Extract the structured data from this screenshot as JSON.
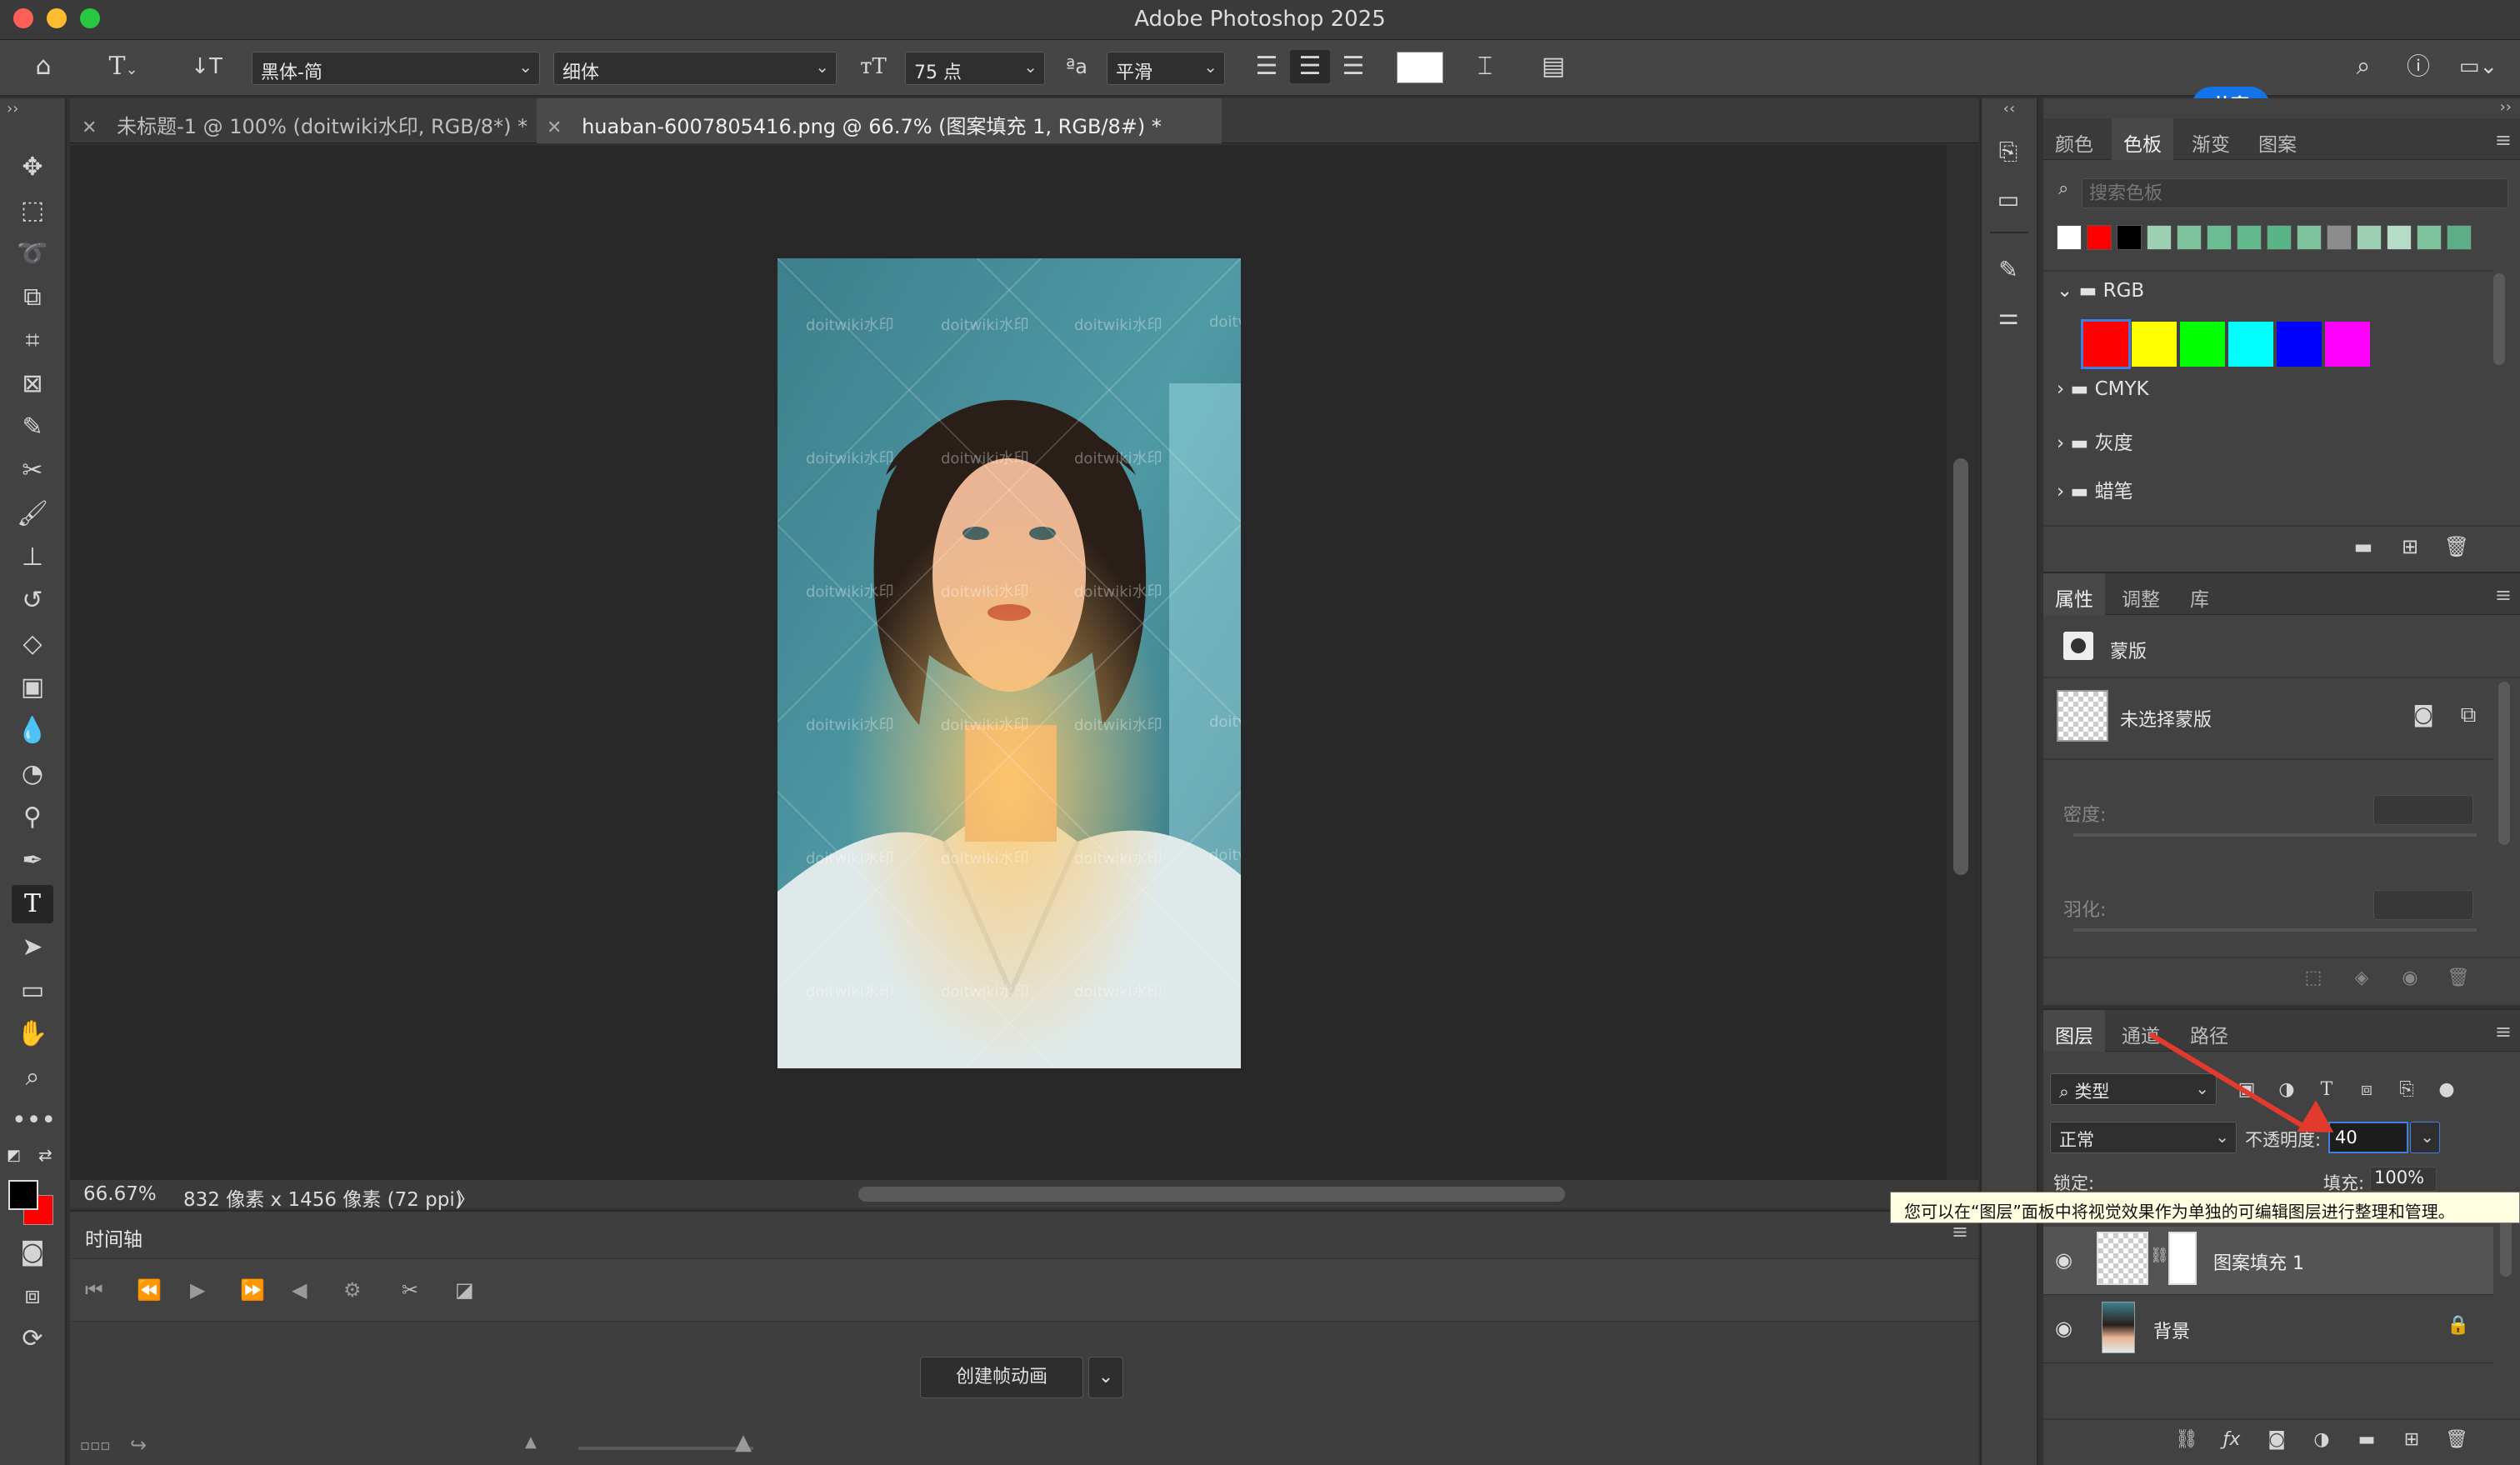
{
  "window": {
    "title": "Adobe Photoshop 2025"
  },
  "options": {
    "font_family": "黑体-简",
    "font_style": "细体",
    "font_size": "75 点",
    "aa_icon_text": "ªa",
    "antialias": "平滑",
    "share_label": "共享"
  },
  "tabs": [
    {
      "label": "未标题-1 @ 100% (doitwiki水印, RGB/8*) *",
      "active": false
    },
    {
      "label": "huaban-6007805416.png @ 66.7% (图案填充 1, RGB/8#) *",
      "active": true
    }
  ],
  "watermark_text": "doitwiki水印",
  "watermark_cut": "doitv",
  "status": {
    "zoom": "66.67%",
    "info": "832 像素 x 1456 像素 (72 ppi)",
    "chevron": "〉"
  },
  "timeline": {
    "title": "时间轴",
    "create_label": "创建帧动画"
  },
  "swatches_panel": {
    "tabs": [
      "颜色",
      "色板",
      "渐变",
      "图案"
    ],
    "active_tab": "色板",
    "search_placeholder": "搜索色板",
    "recent_colors": [
      "#ffffff",
      "#ff0000",
      "#000000",
      "#9ed0b4",
      "#7cc39e",
      "#6bbd93",
      "#62b98c",
      "#59b585",
      "#7cc39e",
      "#8c8c8c",
      "#9ed0b4",
      "#b4dcc6",
      "#7cc39e",
      "#5cae86"
    ],
    "groups": [
      {
        "name": "RGB",
        "expanded": true,
        "colors": [
          "#ff0000",
          "#ffff00",
          "#00ff00",
          "#00ffff",
          "#0000ff",
          "#ff00ff"
        ]
      },
      {
        "name": "CMYK",
        "expanded": false
      },
      {
        "name": "灰度",
        "expanded": false
      },
      {
        "name": "蜡笔",
        "expanded": false
      }
    ]
  },
  "properties_panel": {
    "tabs": [
      "属性",
      "调整",
      "库"
    ],
    "active_tab": "属性",
    "mask_title": "蒙版",
    "no_mask": "未选择蒙版",
    "density_label": "密度:",
    "feather_label": "羽化:"
  },
  "layers_panel": {
    "tabs": [
      "图层",
      "通道",
      "路径"
    ],
    "active_tab": "图层",
    "filter_label": "类型",
    "blend_mode": "正常",
    "opacity_label": "不透明度:",
    "opacity_value": "40",
    "lock_label": "锁定:",
    "fill_label": "填充:",
    "fill_value": "100%",
    "tooltip": "您可以在“图层”面板中将视觉效果作为单独的可编辑图层进行整理和管理。",
    "layers": [
      {
        "name": "图案填充 1"
      },
      {
        "name": "背景"
      }
    ]
  },
  "colors": {
    "accent": "#1473e6",
    "foreground": "#000000",
    "background": "#ff0000",
    "annotation_arrow": "#e23b2e"
  }
}
